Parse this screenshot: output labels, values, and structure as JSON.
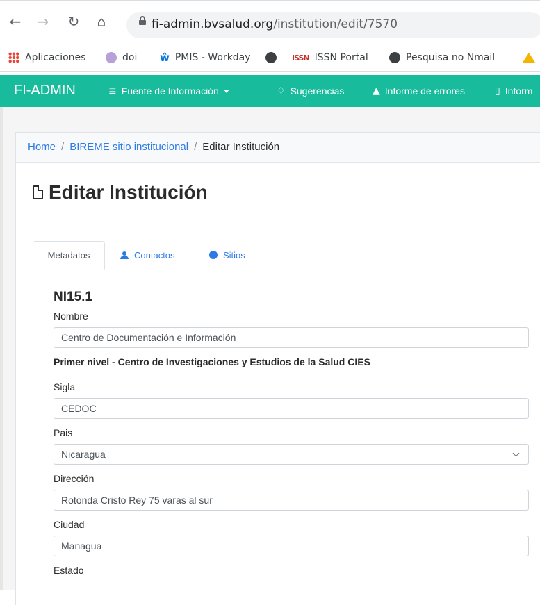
{
  "browser": {
    "url_host": "fi-admin.bvsalud.org",
    "url_path": "/institution/edit/7570",
    "bookmarks": [
      "Aplicaciones",
      "doi",
      "PMIS - Workday",
      "ISSN Portal",
      "Pesquisa no Nmail"
    ]
  },
  "navbar": {
    "brand": "FI-ADMIN",
    "items": [
      "Fuente de Información",
      "Sugerencias",
      "Informe de errores",
      "Inform"
    ]
  },
  "breadcrumb": {
    "home": "Home",
    "parent": "BIREME sitio institucional",
    "current": "Editar Institución"
  },
  "page": {
    "title": "Editar Institución"
  },
  "tabs": [
    "Metadatos",
    "Contactos",
    "Sitios"
  ],
  "form": {
    "code": "NI15.1",
    "nombre_label": "Nombre",
    "nombre_value": "Centro de Documentación e Información",
    "primer_nivel": "Primer nivel - Centro de Investigaciones y Estudios de la Salud CIES",
    "sigla_label": "Sigla",
    "sigla_value": "CEDOC",
    "pais_label": "Pais",
    "pais_value": "Nicaragua",
    "direccion_label": "Dirección",
    "direccion_value": "Rotonda Cristo Rey 75 varas al sur",
    "ciudad_label": "Ciudad",
    "ciudad_value": "Managua",
    "estado_label": "Estado"
  },
  "colors": {
    "navbar": "#18bc9c",
    "link": "#2c7be5"
  }
}
